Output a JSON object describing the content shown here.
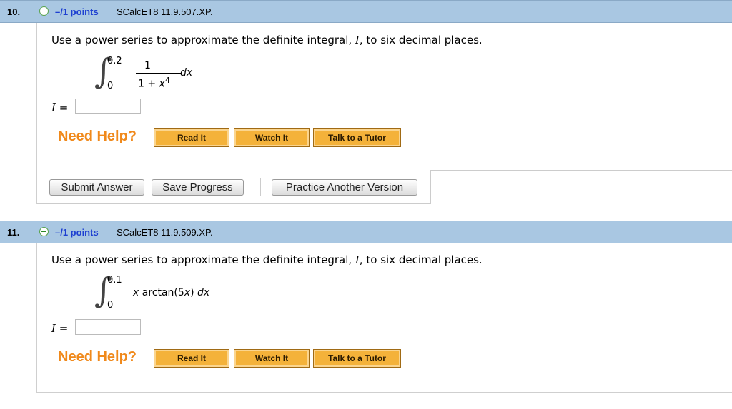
{
  "questions": [
    {
      "number": "10.",
      "points": "–/1 points",
      "code": "SCalcET8 11.9.507.XP.",
      "prompt_pre": "Use a power series to approximate the definite integral, ",
      "prompt_var": "I",
      "prompt_post": ", to six decimal places.",
      "upper": "0.2",
      "lower": "0",
      "numerator": "1",
      "denominator_base": "1 + ",
      "denominator_var": "x",
      "denominator_exp": "4",
      "differential": "dx",
      "i_label": "I",
      "i_eq": " =",
      "answer_value": ""
    },
    {
      "number": "11.",
      "points": "–/1 points",
      "code": "SCalcET8 11.9.509.XP.",
      "prompt_pre": "Use a power series to approximate the definite integral, ",
      "prompt_var": "I",
      "prompt_post": ", to six decimal places.",
      "upper": "0.1",
      "lower": "0",
      "integrand_var": "x",
      "integrand_rest": " arctan(5",
      "integrand_var2": "x",
      "integrand_close": ") ",
      "differential": "dx",
      "i_label": "I",
      "i_eq": " =",
      "answer_value": ""
    }
  ],
  "help": {
    "need_help": "Need Help?",
    "read_it": "Read It",
    "watch_it": "Watch It",
    "talk_to_tutor": "Talk to a Tutor"
  },
  "actions": {
    "submit": "Submit Answer",
    "save": "Save Progress",
    "practice": "Practice Another Version"
  },
  "colors": {
    "header_bg": "#a9c7e2",
    "points_blue": "#1d3fd1",
    "need_help_orange": "#f0891b",
    "help_button": "#f4b23a"
  }
}
